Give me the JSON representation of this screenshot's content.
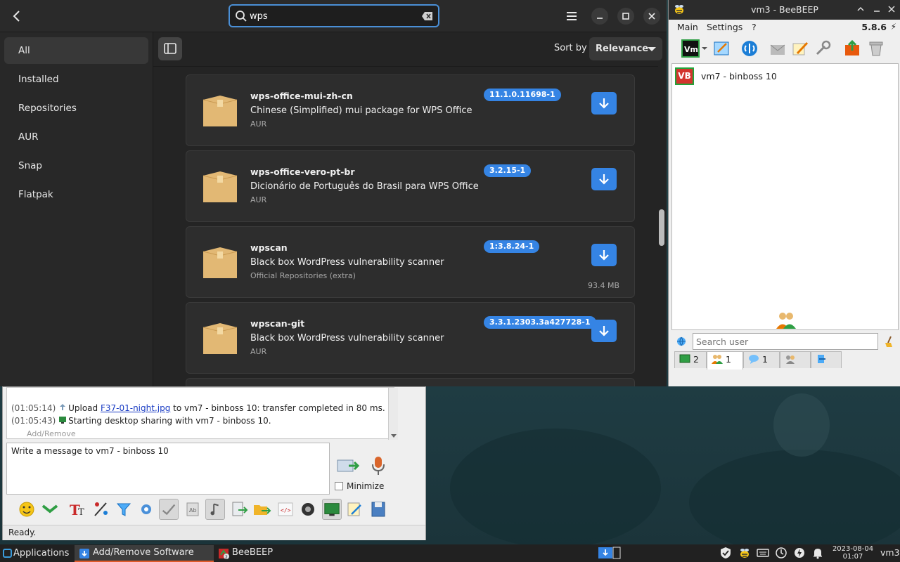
{
  "pamac": {
    "search_value": "wps",
    "sidebar": [
      {
        "label": "All",
        "active": true
      },
      {
        "label": "Installed"
      },
      {
        "label": "Repositories"
      },
      {
        "label": "AUR"
      },
      {
        "label": "Snap"
      },
      {
        "label": "Flatpak"
      }
    ],
    "sort_label": "Sort by",
    "sort_value": "Relevance",
    "packages": [
      {
        "name": "wps-office-mui-zh-cn",
        "description": "Chinese (Simplified) mui package for WPS Office",
        "repo": "AUR",
        "version": "11.1.0.11698-1",
        "size": ""
      },
      {
        "name": "wps-office-vero-pt-br",
        "description": "Dicionário de Português do Brasil para WPS Office",
        "repo": "AUR",
        "version": "3.2.15-1",
        "size": ""
      },
      {
        "name": "wpscan",
        "description": "Black box WordPress vulnerability scanner",
        "repo": "Official Repositories (extra)",
        "version": "1:3.8.24-1",
        "size": "93.4 MB"
      },
      {
        "name": "wpscan-git",
        "description": "Black box WordPress vulnerability scanner",
        "repo": "AUR",
        "version": "3.3.1.2303.3a427728-1",
        "size": ""
      }
    ],
    "accent_color": "#3584e4"
  },
  "chat": {
    "log": [
      {
        "time": "(01:05:14)",
        "prefix": "Upload ",
        "link": "F37-01-night.jpg",
        "suffix": " to vm7 - binboss 10: transfer completed in 80 ms."
      },
      {
        "time": "(01:05:43)",
        "prefix": "Starting desktop sharing with vm7 - binboss 10.",
        "link": "",
        "suffix": ""
      }
    ],
    "ghost_label": "Add/Remove",
    "message_placeholder": "Write a message to vm7 - binboss 10",
    "minimize_label": "Minimize",
    "status": "Ready."
  },
  "bee": {
    "title": "vm3 - BeeBEEP",
    "menus": [
      "Main",
      "Settings",
      "?"
    ],
    "version": "5.8.6",
    "user": {
      "initials": "VB",
      "name": "vm7 - binboss 10"
    },
    "search_placeholder": "Search user",
    "tabs": [
      {
        "count": "2"
      },
      {
        "count": "1"
      },
      {
        "count": "1"
      },
      {
        "count": ""
      },
      {
        "count": ""
      }
    ]
  },
  "taskbar": {
    "applications_label": "Applications",
    "tasks": [
      {
        "label": "Add/Remove Software",
        "active": true
      },
      {
        "label": "BeeBEEP",
        "badge": "2"
      }
    ],
    "clock_date": "2023-08-04",
    "clock_time": "01:07",
    "hostname": "vm3"
  }
}
